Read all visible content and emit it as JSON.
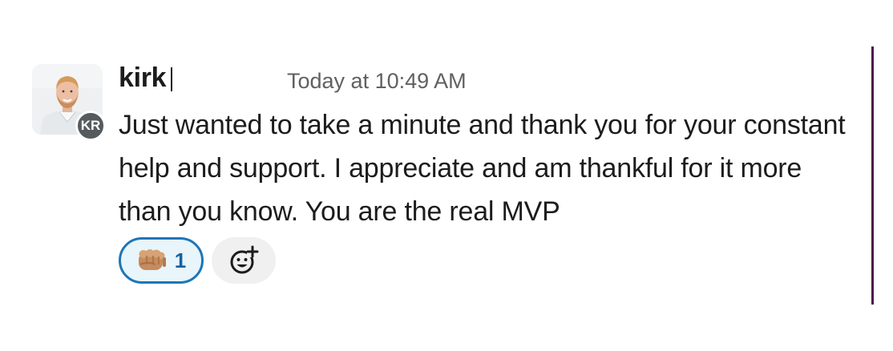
{
  "message": {
    "author": "kirk",
    "author_initials": "KR",
    "timestamp": "Today at 10:49 AM",
    "text": "Just wanted to take a minute and thank you for your constant help and support. I appreciate and am thankful for it more than you know. You are the real MVP"
  },
  "reactions": [
    {
      "emoji": "oncoming-fist-emoji",
      "count": "1",
      "selected": true
    }
  ],
  "add_reaction_icon": "add-reaction-icon",
  "colors": {
    "reaction_border": "#1d76b8",
    "reaction_bg": "#e8f5fa",
    "reaction_count": "#1264a3",
    "sidebar_rule": "#4a154b",
    "initials_badge": "#555a5e"
  }
}
